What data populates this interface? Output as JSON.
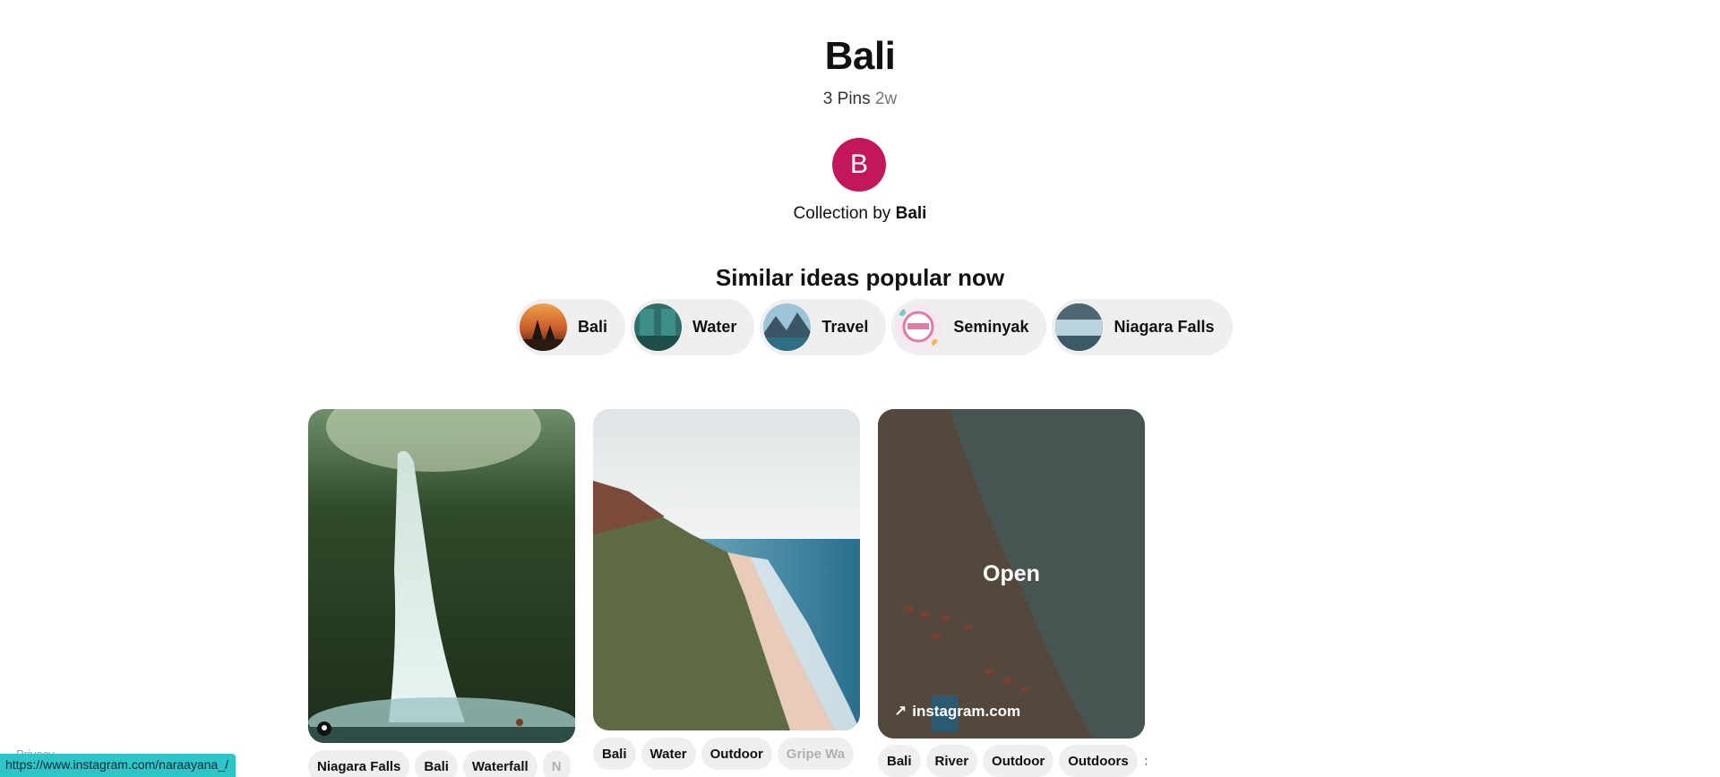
{
  "board": {
    "title": "Bali",
    "pins_count": "3 Pins",
    "age": "2w",
    "avatar_letter": "B",
    "collection_prefix": "Collection by",
    "owner": "Bali",
    "avatar_color": "#c2185b"
  },
  "similar": {
    "title": "Similar ideas popular now",
    "chips": [
      {
        "label": "Bali"
      },
      {
        "label": "Water"
      },
      {
        "label": "Travel"
      },
      {
        "label": "Seminyak"
      },
      {
        "label": "Niagara Falls"
      }
    ]
  },
  "pins": [
    {
      "tags": [
        "Niagara Falls",
        "Bali",
        "Waterfall",
        "N"
      ]
    },
    {
      "tags": [
        "Bali",
        "Water",
        "Outdoor",
        "Gripe Wa"
      ]
    },
    {
      "overlay_label": "Open",
      "link_text": "instagram.com",
      "tags": [
        "Bali",
        "River",
        "Outdoor",
        "Outdoors"
      ]
    }
  ],
  "status_bar": {
    "url": "https://www.instagram.com/naraayana_/"
  },
  "privacy_ghost": "Privacy"
}
